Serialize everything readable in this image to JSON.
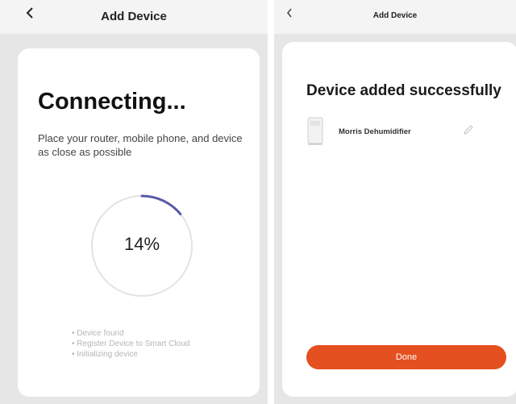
{
  "left_screen": {
    "title": "Add Device",
    "heading": "Connecting...",
    "hint": "Place your router, mobile phone, and device as close as possible",
    "progress": {
      "percent": 14,
      "label": "14%"
    },
    "steps": [
      "Device found",
      "Register Device to Smart Cloud",
      "Initializing device"
    ]
  },
  "right_screen": {
    "title": "Add Device",
    "heading": "Device added successfully",
    "device": {
      "name": "Morris Dehumidifier"
    },
    "done_label": "Done"
  },
  "colors": {
    "accent": "#e4501f",
    "progress_arc": "#5a5aa8",
    "progress_track": "#e3e3e3",
    "panel_bg": "#e6e6e6"
  },
  "icons": {
    "back": "chevron-left-icon",
    "edit": "pencil-icon",
    "device": "dehumidifier-icon"
  }
}
